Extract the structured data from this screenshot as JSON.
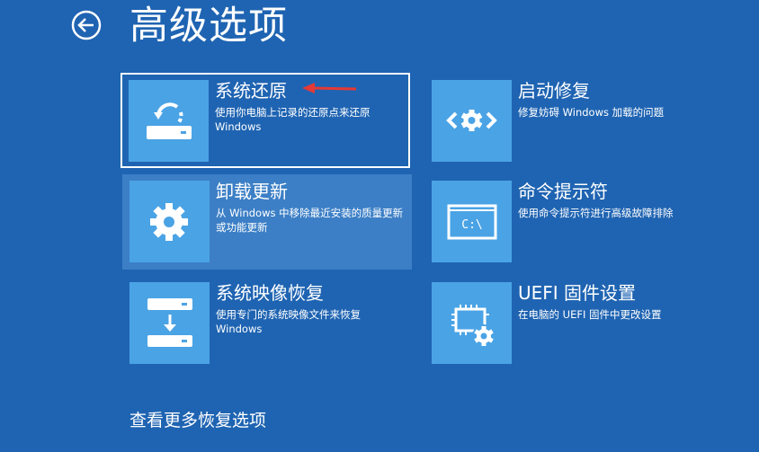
{
  "page": {
    "title": "高级选项",
    "more_options": "查看更多恢复选项"
  },
  "options": {
    "system_restore": {
      "title": "系统还原",
      "description": "使用你电脑上记录的还原点来还原 Windows",
      "icon": "system-restore-icon"
    },
    "uninstall_updates": {
      "title": "卸载更新",
      "description": "从 Windows 中移除最近安装的质量更新或功能更新",
      "icon": "gear-icon"
    },
    "system_image_recovery": {
      "title": "系统映像恢复",
      "description": "使用专门的系统映像文件来恢复 Windows",
      "icon": "drive-download-icon"
    },
    "startup_repair": {
      "title": "启动修复",
      "description": "修复妨碍 Windows 加载的问题",
      "icon": "startup-repair-icon"
    },
    "command_prompt": {
      "title": "命令提示符",
      "description": "使用命令提示符进行高级故障排除",
      "icon": "command-prompt-icon",
      "icon_text": "C:\\"
    },
    "uefi_settings": {
      "title": "UEFI 固件设置",
      "description": "在电脑的 UEFI 固件中更改设置",
      "icon": "uefi-chip-gear-icon"
    }
  },
  "colors": {
    "background": "#1f64b2",
    "tile": "#4aa3e5",
    "hover_highlight": "#3c7fc6",
    "focus_border": "#ffffff",
    "annotation_arrow": "#e53935"
  }
}
